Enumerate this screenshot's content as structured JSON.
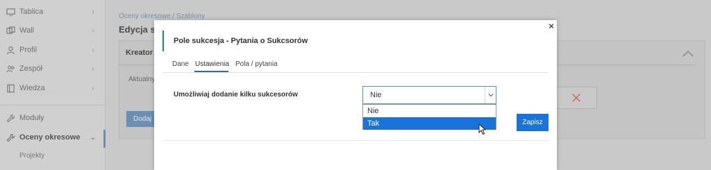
{
  "sidebar": {
    "items": [
      {
        "label": "Tablica",
        "icon": "monitor-icon"
      },
      {
        "label": "Wall",
        "icon": "cards-icon"
      },
      {
        "label": "Profil",
        "icon": "user-icon"
      },
      {
        "label": "Zespół",
        "icon": "team-icon"
      },
      {
        "label": "Wiedza",
        "icon": "book-icon"
      },
      {
        "label": "Moduły",
        "icon": "wrench-icon"
      },
      {
        "label": "Oceny okresowe",
        "icon": "wrench-icon"
      }
    ],
    "sub_item": "Projekty"
  },
  "background": {
    "breadcrumb_link": "Oceny okresowe",
    "breadcrumb_current": "Szablony",
    "page_title": "Edycja sz",
    "panel_title": "Kreator",
    "panel_label": "Aktualny",
    "add_button": "Dodaj"
  },
  "modal": {
    "title": "Pole sukcesja - Pytania o Sukcsorów",
    "close_glyph": "×",
    "tabs": [
      "Dane",
      "Ustawienia",
      "Pola / pytania"
    ],
    "active_tab": "Ustawienia",
    "field_label": "Umożliwiaj dodanie kilku sukcesorów",
    "select_value": "Nie",
    "options": [
      "Nie",
      "Tak"
    ],
    "highlighted_option": "Tak",
    "save_button": "Zapisz"
  },
  "colors": {
    "accent": "#1a73d9",
    "header_bar": "#1f8a5a",
    "overlay_bg": "#c9c9c9"
  }
}
